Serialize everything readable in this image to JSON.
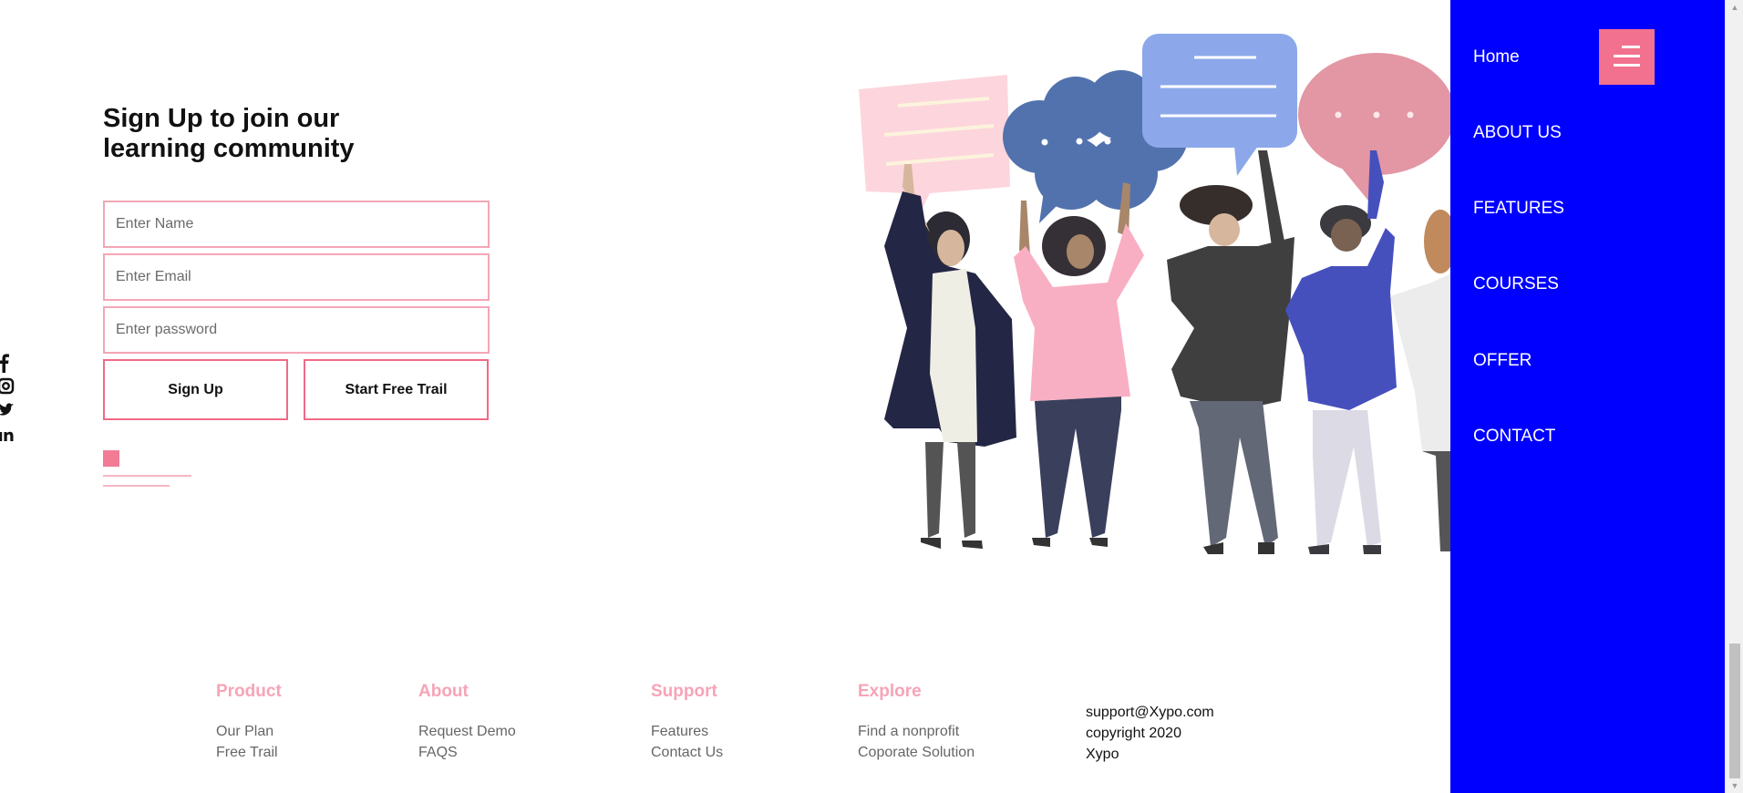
{
  "signup": {
    "heading": "Sign Up to join our learning community",
    "name_placeholder": "Enter Name",
    "email_placeholder": "Enter Email",
    "password_placeholder": "Enter password",
    "signup_label": "Sign Up",
    "trial_label": "Start Free Trail"
  },
  "social": {
    "icons": [
      "facebook-icon",
      "instagram-icon",
      "twitter-icon",
      "linkedin-icon"
    ]
  },
  "nav": {
    "items": [
      "Home",
      "ABOUT US",
      "FEATURES",
      "COURSES",
      "OFFER",
      "CONTACT"
    ],
    "menu_icon": "hamburger-menu-icon"
  },
  "footer": {
    "product": {
      "title": "Product",
      "links": [
        "Our Plan",
        "Free Trail"
      ]
    },
    "about": {
      "title": "About",
      "links": [
        "Request Demo",
        "FAQS"
      ]
    },
    "support": {
      "title": "Support",
      "links": [
        "Features",
        "Contact Us"
      ]
    },
    "explore": {
      "title": "Explore",
      "links": [
        "Find a nonprofit",
        "Coporate Solution"
      ]
    },
    "contact": {
      "email": "support@Xypo.com",
      "copyright": "copyright 2020",
      "brand": "Xypo"
    }
  },
  "colors": {
    "accent_pink": "#f2718e",
    "nav_blue": "#0000ff",
    "footer_heading": "#f6a4b7"
  }
}
